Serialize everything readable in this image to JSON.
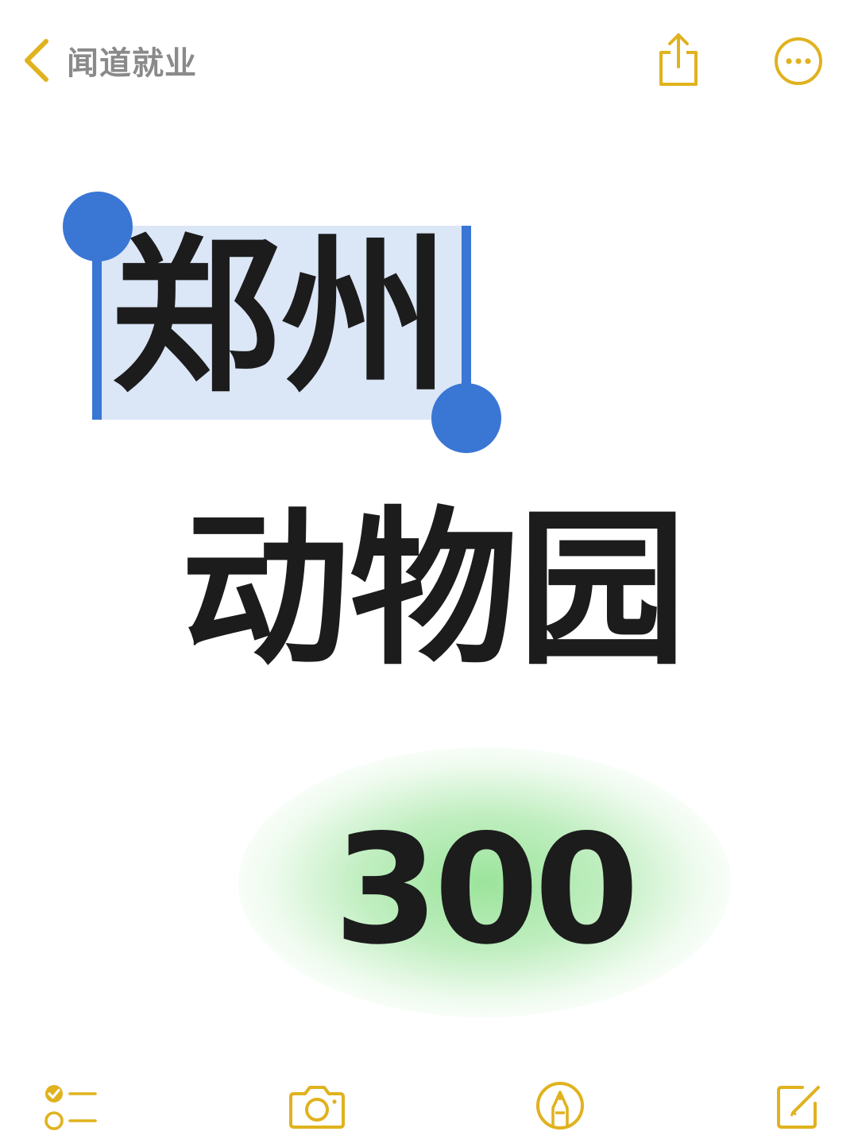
{
  "colors": {
    "accent": "#e0b21e",
    "selection_handle": "#3a76d4",
    "selection_fill": "#dbe6f7",
    "glow": "#9ee29e",
    "text": "#1c1c1c",
    "nav_label": "#8a8a8a"
  },
  "nav": {
    "back_icon": "chevron-left-icon",
    "back_label": "闻道就业",
    "share_icon": "share-icon",
    "more_icon": "more-options-icon"
  },
  "note": {
    "line1": "郑州",
    "line2": "动物园",
    "price": "300"
  },
  "toolbar": {
    "checklist_icon": "checklist-icon",
    "camera_icon": "camera-icon",
    "markup_icon": "markup-pen-icon",
    "compose_icon": "compose-icon"
  }
}
